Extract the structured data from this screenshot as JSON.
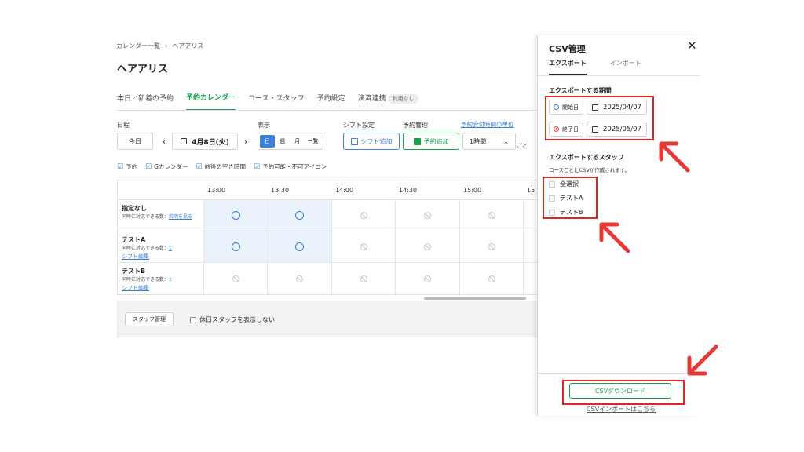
{
  "breadcrumb": {
    "root": "カレンダー一覧",
    "sep": "›",
    "current": "ヘアアリス"
  },
  "page_title": "ヘアアリス",
  "tabs": [
    {
      "label": "本日／新着の予約"
    },
    {
      "label": "予約カレンダー"
    },
    {
      "label": "コース・スタッフ"
    },
    {
      "label": "予約設定"
    },
    {
      "label": "決済連携"
    }
  ],
  "tab_badge": "利用なし",
  "controls": {
    "date_label": "日程",
    "today": "今日",
    "date": "4月8日(火)",
    "view_label": "表示",
    "view_options": [
      "日",
      "週",
      "月",
      "一覧"
    ],
    "shift_label": "シフト設定",
    "shift_add": "シフト追加",
    "reserve_label": "予約管理",
    "reserve_add": "予約追加",
    "unit_link": "予約受付時間の単位",
    "unit_value": "1時間",
    "unit_suffix": "ごと"
  },
  "filters": [
    "予約",
    "Gカレンダー",
    "前後の空き時間",
    "予約可能・不可アイコン"
  ],
  "grid": {
    "times": [
      "13:00",
      "13:30",
      "14:00",
      "14:30",
      "15:00",
      "15"
    ],
    "rows": [
      {
        "name": "指定なし",
        "sub": "同時に対応できる数：",
        "link": "説明を見る",
        "link2": "",
        "cells": [
          "avail",
          "avail",
          "na",
          "na",
          "na",
          "na"
        ]
      },
      {
        "name": "テストA",
        "sub": "同時に対応できる数：",
        "link": "1",
        "link2": "シフト編集",
        "cells": [
          "avail",
          "avail",
          "na",
          "na",
          "na",
          "na"
        ]
      },
      {
        "name": "テストB",
        "sub": "同時に対応できる数：",
        "link": "1",
        "link2": "シフト編集",
        "cells": [
          "na",
          "na",
          "na",
          "na",
          "na",
          "na"
        ]
      }
    ]
  },
  "footer": {
    "staff_btn": "スタッフ管理",
    "holiday_label": "休日スタッフを表示しない"
  },
  "csv_panel": {
    "title": "CSV管理",
    "close": "✕",
    "tabs": [
      "エクスポート",
      "インポート"
    ],
    "period_heading": "エクスポートする期間",
    "start_label": "開始日",
    "start_date": "2025/04/07",
    "end_label": "終了日",
    "end_date": "2025/05/07",
    "staff_heading": "エクスポートするスタッフ",
    "staff_note": "コースごとにCSVが作成されます。",
    "staff_items": [
      "全選択",
      "テストA",
      "テストB"
    ],
    "download": "CSVダウンロード",
    "import_link": "CSVインポートはこちら"
  },
  "colors": {
    "accent_green": "#16a34a",
    "accent_blue": "#3b7fd9",
    "highlight_red": "#e02424"
  }
}
